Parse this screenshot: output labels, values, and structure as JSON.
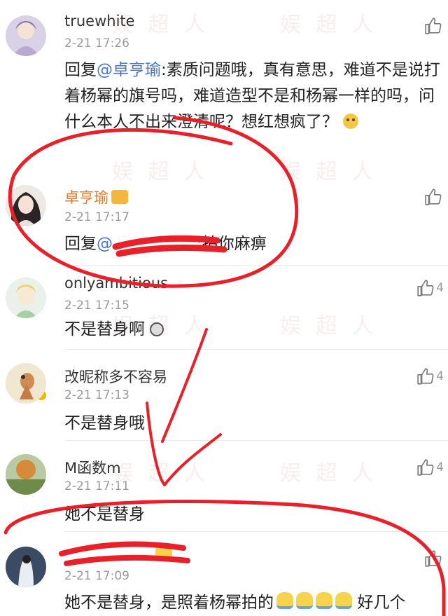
{
  "comments": [
    {
      "username": "truewhite",
      "time": "2-21 17:26",
      "text_prefix": "回复",
      "mention": "@卓亨瑜",
      "text": ":素质问题哦，真有意思，难道不是说打着杨幂的旗号吗，难道造型不是和杨幂一样的吗，问什么本人不出来澄清呢？想红想疯了？",
      "likes": ""
    },
    {
      "username": "卓亨瑜",
      "time": "2-21 17:17",
      "text_prefix": "回复",
      "mention": "@",
      "text": ":拍你麻痹",
      "likes": ""
    },
    {
      "username": "onlyambitious",
      "time": "2-21 17:15",
      "text": "不是替身啊",
      "likes": "4"
    },
    {
      "username": "改昵称多不容易",
      "time": "2-21 17:13",
      "text": "不是替身哦",
      "likes": "4"
    },
    {
      "username": "M函数m",
      "time": "2-21 17:11",
      "text": "她不是替身",
      "likes": "4"
    },
    {
      "username": "",
      "time": "2-21 17:09",
      "text": "她不是替身，是照着杨幂拍的",
      "text_suffix": "好几个",
      "likes": ""
    }
  ],
  "watermark": "娱 超 人",
  "colors": {
    "annotation_red": "#e8202a",
    "mention_blue": "#4b76c0",
    "vip_gold": "#e07c2f"
  },
  "icons": [
    "thumb-up-icon",
    "smile-emoji-icon",
    "panda-emoji-icon",
    "chick-emoji-icon",
    "crown-badge-icon"
  ]
}
